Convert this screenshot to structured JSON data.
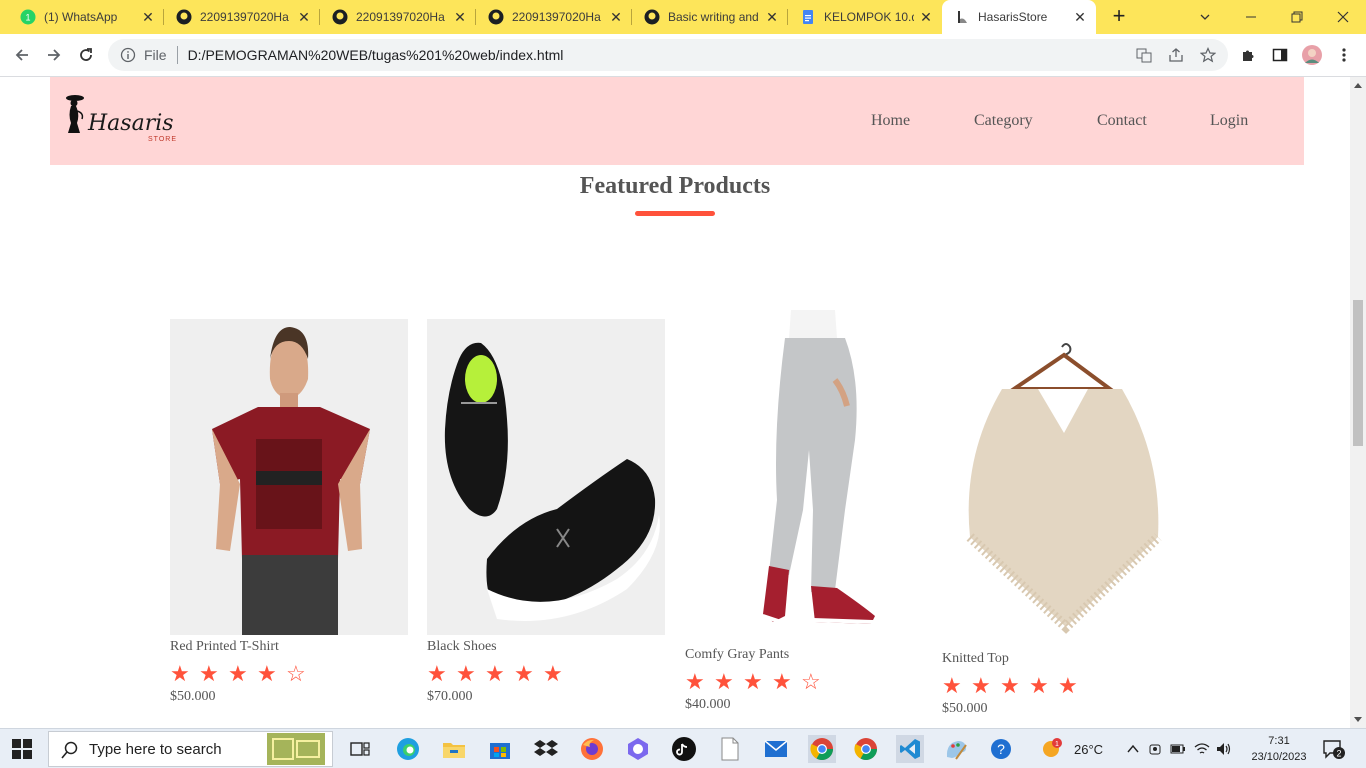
{
  "browser": {
    "tabs": [
      {
        "title": "(1) WhatsApp",
        "icon": "whatsapp-icon",
        "badge": "1",
        "active": false
      },
      {
        "title": "22091397020Ha",
        "icon": "github-icon",
        "active": false
      },
      {
        "title": "22091397020Ha",
        "icon": "github-icon",
        "active": false
      },
      {
        "title": "22091397020Ha",
        "icon": "github-icon",
        "active": false
      },
      {
        "title": "Basic writing and",
        "icon": "github-icon",
        "active": false
      },
      {
        "title": "KELOMPOK 10.d",
        "icon": "docs-icon",
        "active": false
      },
      {
        "title": "HasarisStore",
        "icon": "site-icon",
        "active": true
      }
    ],
    "new_tab": "+",
    "address": {
      "scheme_label": "File",
      "url": "D:/PEMOGRAMAN%20WEB/tugas%201%20web/index.html"
    }
  },
  "site": {
    "logo_text": "Hasaris",
    "logo_sub": "STORE",
    "nav": [
      "Home",
      "Category",
      "Contact",
      "Login"
    ],
    "section_title": "Featured Products",
    "accent_color": "#ff523b",
    "header_color": "#ffd6d6",
    "products": [
      {
        "name": "Red Printed T-Shirt",
        "rating": 4,
        "price": "$50.000"
      },
      {
        "name": "Black Shoes",
        "rating": 5,
        "price": "$70.000"
      },
      {
        "name": "Comfy Gray Pants",
        "rating": 4,
        "price": "$40.000"
      },
      {
        "name": "Knitted Top",
        "rating": 5,
        "price": "$50.000"
      }
    ]
  },
  "taskbar": {
    "search_placeholder": "Type here to search",
    "weather_temp": "26°C",
    "weather_badge": "1",
    "time": "7:31",
    "date": "23/10/2023",
    "notification_count": "2"
  }
}
